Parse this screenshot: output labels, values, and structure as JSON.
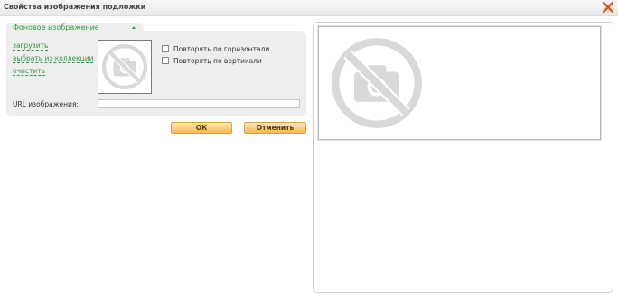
{
  "window": {
    "title": "Свойства изображения подложки"
  },
  "section": {
    "label": "Фоновое изображение"
  },
  "links": {
    "upload": "загрузить",
    "collection": "выбрать из коллекции",
    "clear": "очистить"
  },
  "options": {
    "repeat_horizontal": "Повторять по горизонтали",
    "repeat_vertical": "Повторять по вертикали",
    "repeat_horizontal_checked": false,
    "repeat_vertical_checked": false
  },
  "url": {
    "label": "URL изображения:",
    "value": ""
  },
  "buttons": {
    "ok": "ОК",
    "cancel": "Отменить"
  },
  "colors": {
    "accent_green": "#2f9e44",
    "button_orange": "#f6b95a",
    "close_orange": "#e2541c"
  },
  "icons": {
    "thumbnail": "no-image-icon",
    "preview": "no-image-icon",
    "close": "close-icon"
  }
}
